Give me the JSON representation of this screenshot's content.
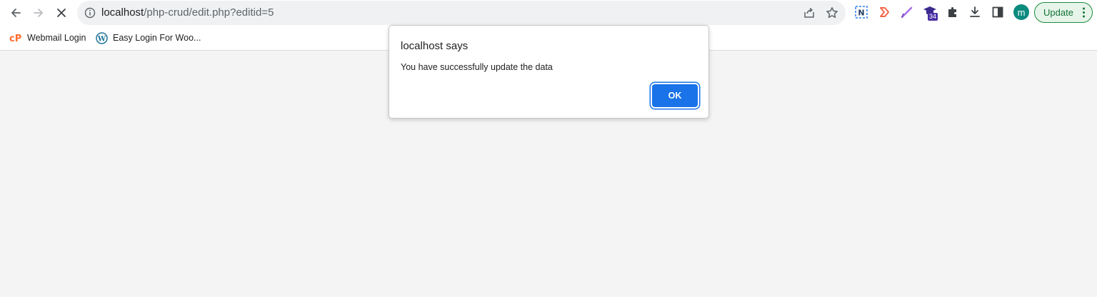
{
  "toolbar": {
    "url_host": "localhost",
    "url_path": "/php-crud/edit.php?editid=5",
    "avatar_letter": "m",
    "update_label": "Update",
    "extension_badge": "34",
    "icons": [
      "back-icon",
      "forward-icon",
      "stop-icon",
      "info-icon",
      "share-icon",
      "star-icon",
      "notion-extension-icon",
      "arrow-extension-icon",
      "pen-extension-icon",
      "graduation-cap-extension-icon",
      "puzzle-icon",
      "download-icon",
      "side-panel-icon",
      "kebab-menu-icon"
    ]
  },
  "bookmarks": [
    {
      "label": "Webmail Login",
      "icon": "cpanel-icon"
    },
    {
      "label": "Easy Login For Woo...",
      "icon": "wordpress-icon"
    }
  ],
  "dialog": {
    "title": "localhost says",
    "message": "You have successfully update the data",
    "ok_label": "OK"
  },
  "colors": {
    "accent": "#1a73e8",
    "update_green": "#137333",
    "avatar": "#0b8a7e",
    "page_bg": "#f4f4f4"
  }
}
